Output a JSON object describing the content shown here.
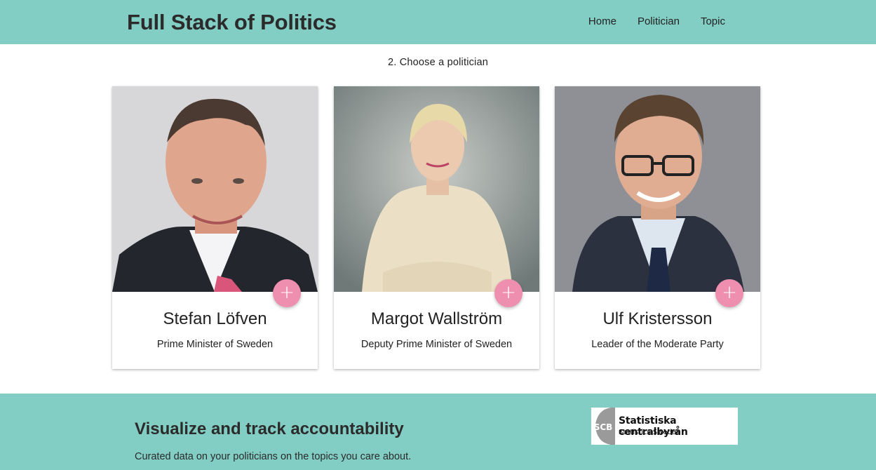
{
  "header": {
    "brand": "Full Stack of Politics",
    "nav": [
      "Home",
      "Politician",
      "Topic"
    ]
  },
  "main": {
    "step_label": "2. Choose a politician",
    "add_symbol": "+",
    "cards": [
      {
        "name": "Stefan Löfven",
        "role": "Prime Minister of Sweden"
      },
      {
        "name": "Margot Wallström",
        "role": "Deputy Prime Minister of Sweden"
      },
      {
        "name": "Ulf Kristersson",
        "role": "Leader of the Moderate Party"
      }
    ]
  },
  "footer": {
    "title": "Visualize and track accountability",
    "subtitle": "Curated data on your politicians on the topics you care about.",
    "logo": {
      "mark": "SCB",
      "title": "Statistiska centralbyrån",
      "subtitle": "Statistics Sweden"
    }
  },
  "colors": {
    "accent": "#82cdc4",
    "fab": "#ef8fb0"
  }
}
